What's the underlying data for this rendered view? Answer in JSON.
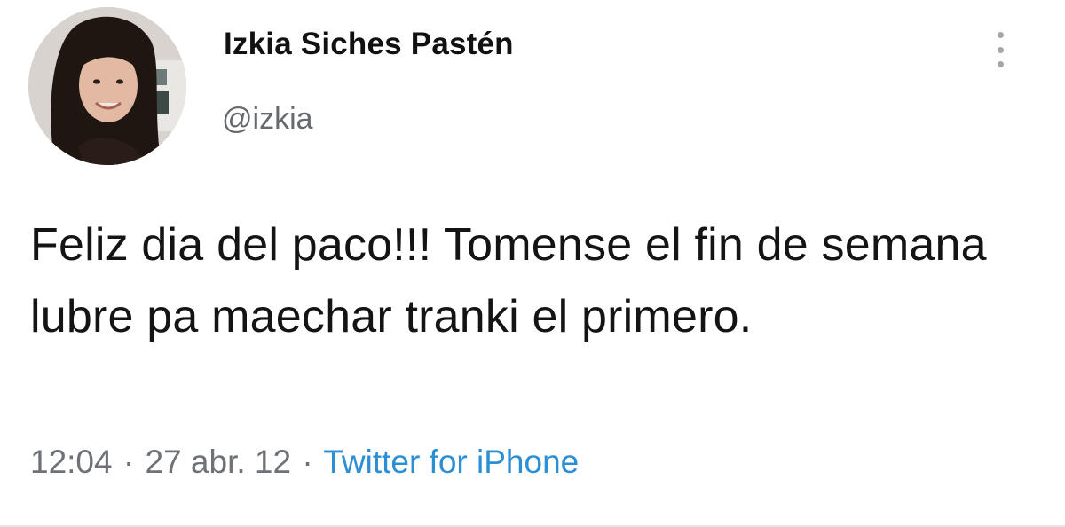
{
  "tweet": {
    "display_name": "Izkia Siches Pastén",
    "handle": "@izkia",
    "text": "Feliz dia del paco!!! Tomense el fin de semana lubre pa maechar tranki el primero.",
    "time": "12:04",
    "separator": "·",
    "date": "27 abr. 12",
    "source": "Twitter for iPhone"
  },
  "icons": {
    "more": "more-vertical-icon",
    "avatar": "profile-avatar"
  },
  "colors": {
    "source_link": "#2c8fd4",
    "muted_text": "#6e7276",
    "primary_text": "#141414"
  }
}
